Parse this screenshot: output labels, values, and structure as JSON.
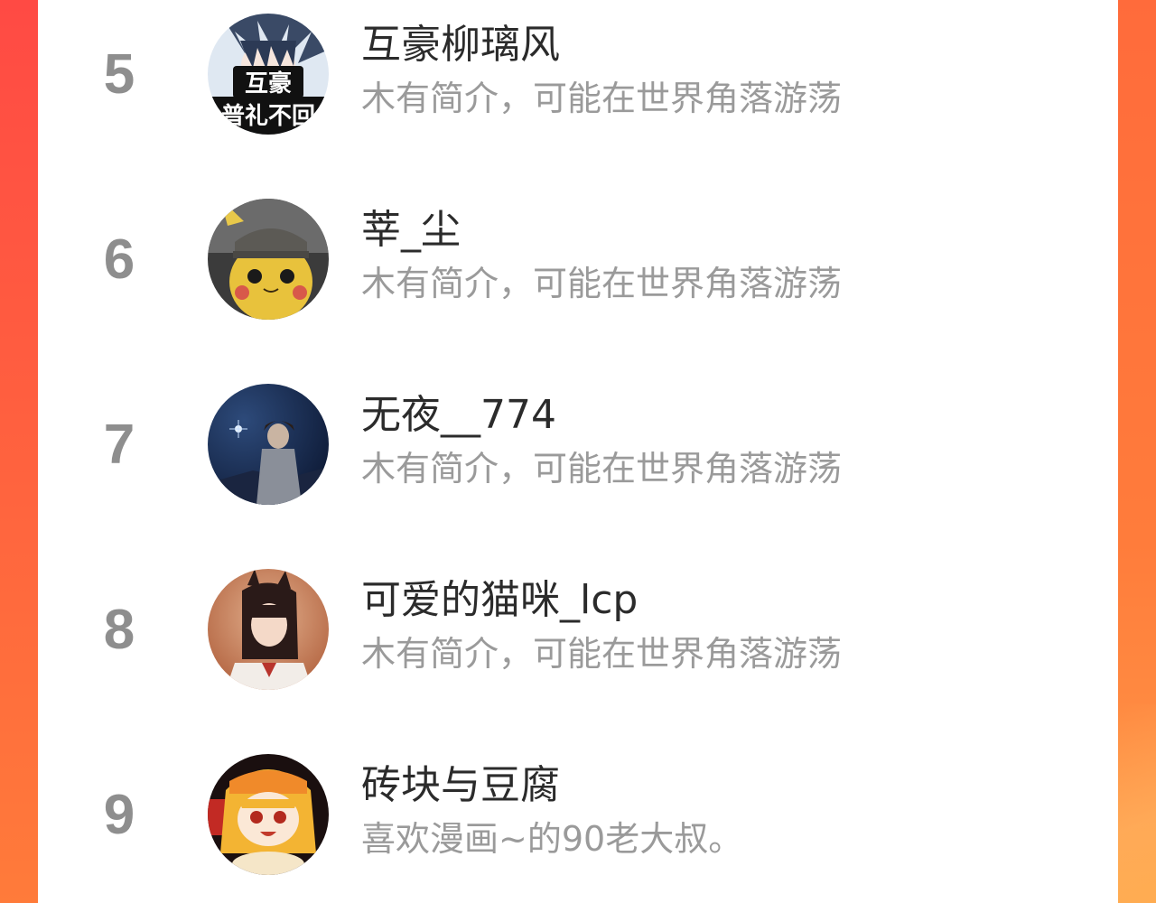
{
  "ranking": {
    "items": [
      {
        "rank": "5",
        "name": "互豪柳璃风",
        "bio": "木有简介，可能在世界角落游荡",
        "avatar_icon": "anime-boy-avatar-icon",
        "avatar_text": [
          "互豪",
          "普礼不回"
        ]
      },
      {
        "rank": "6",
        "name": "莘_尘",
        "bio": "木有简介，可能在世界角落游荡",
        "avatar_icon": "detective-pikachu-avatar-icon"
      },
      {
        "rank": "7",
        "name": "无夜__774",
        "bio": "木有简介，可能在世界角落游荡",
        "avatar_icon": "night-warrior-avatar-icon"
      },
      {
        "rank": "8",
        "name": "可爱的猫咪_lcp",
        "bio": "木有简介，可能在世界角落游荡",
        "avatar_icon": "cosplay-girl-avatar-icon"
      },
      {
        "rank": "9",
        "name": "砖块与豆腐",
        "bio": "喜欢漫画~的90老大叔。",
        "avatar_icon": "umaru-anime-avatar-icon"
      }
    ]
  },
  "colors": {
    "background_accent": "#ff5a40",
    "panel": "#ffffff",
    "rank_number": "#8e8e8e",
    "name_text": "#2b2b2b",
    "bio_text": "#9a9a9a"
  }
}
